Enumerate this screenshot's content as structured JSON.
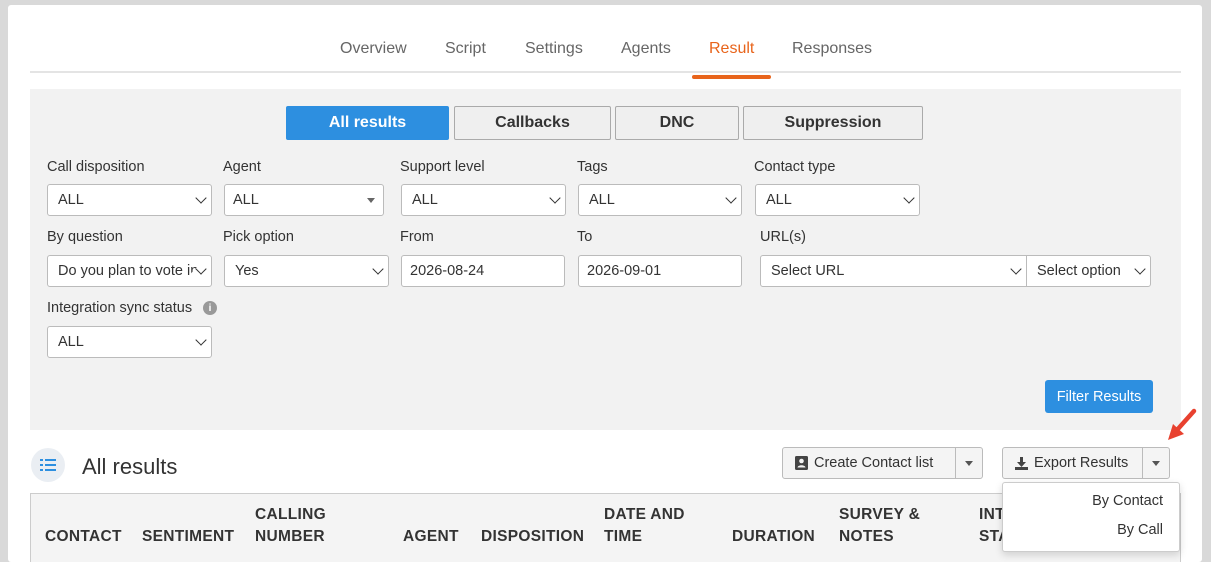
{
  "tabs": [
    "Overview",
    "Script",
    "Settings",
    "Agents",
    "Result",
    "Responses"
  ],
  "active_tab": "Result",
  "segments": [
    "All results",
    "Callbacks",
    "DNC",
    "Suppression"
  ],
  "filters": {
    "call_disposition": {
      "label": "Call disposition",
      "value": "ALL"
    },
    "agent": {
      "label": "Agent",
      "value": "ALL"
    },
    "support_level": {
      "label": "Support level",
      "value": "ALL"
    },
    "tags": {
      "label": "Tags",
      "value": "ALL"
    },
    "contact_type": {
      "label": "Contact type",
      "value": "ALL"
    },
    "by_question": {
      "label": "By question",
      "value": "Do you plan to vote in"
    },
    "pick_option": {
      "label": "Pick option",
      "value": "Yes"
    },
    "from": {
      "label": "From",
      "value": "2026-08-24"
    },
    "to": {
      "label": "To",
      "value": "2026-09-01"
    },
    "urls": {
      "label": "URL(s)",
      "value": "Select URL",
      "option_value": "Select option"
    },
    "integration_sync": {
      "label": "Integration sync status",
      "value": "ALL",
      "info": "i"
    }
  },
  "filter_button": "Filter Results",
  "results": {
    "title": "All results",
    "create_contact_list": "Create Contact list",
    "export_results": "Export Results",
    "export_menu": [
      "By Contact",
      "By Call"
    ]
  },
  "table_headers": {
    "contact": "CONTACT",
    "sentiment": "SENTIMENT",
    "calling_1": "CALLING",
    "calling_2": "NUMBER",
    "agent": "AGENT",
    "disposition": "DISPOSITION",
    "date_1": "DATE AND",
    "date_2": "TIME",
    "duration": "DURATION",
    "survey_1": "SURVEY &",
    "survey_2": "NOTES",
    "int_1": "INT",
    "int_2": "STA"
  },
  "colors": {
    "accent": "#e8641b",
    "primary": "#2d8fe0",
    "annotation": "#e8412f"
  }
}
